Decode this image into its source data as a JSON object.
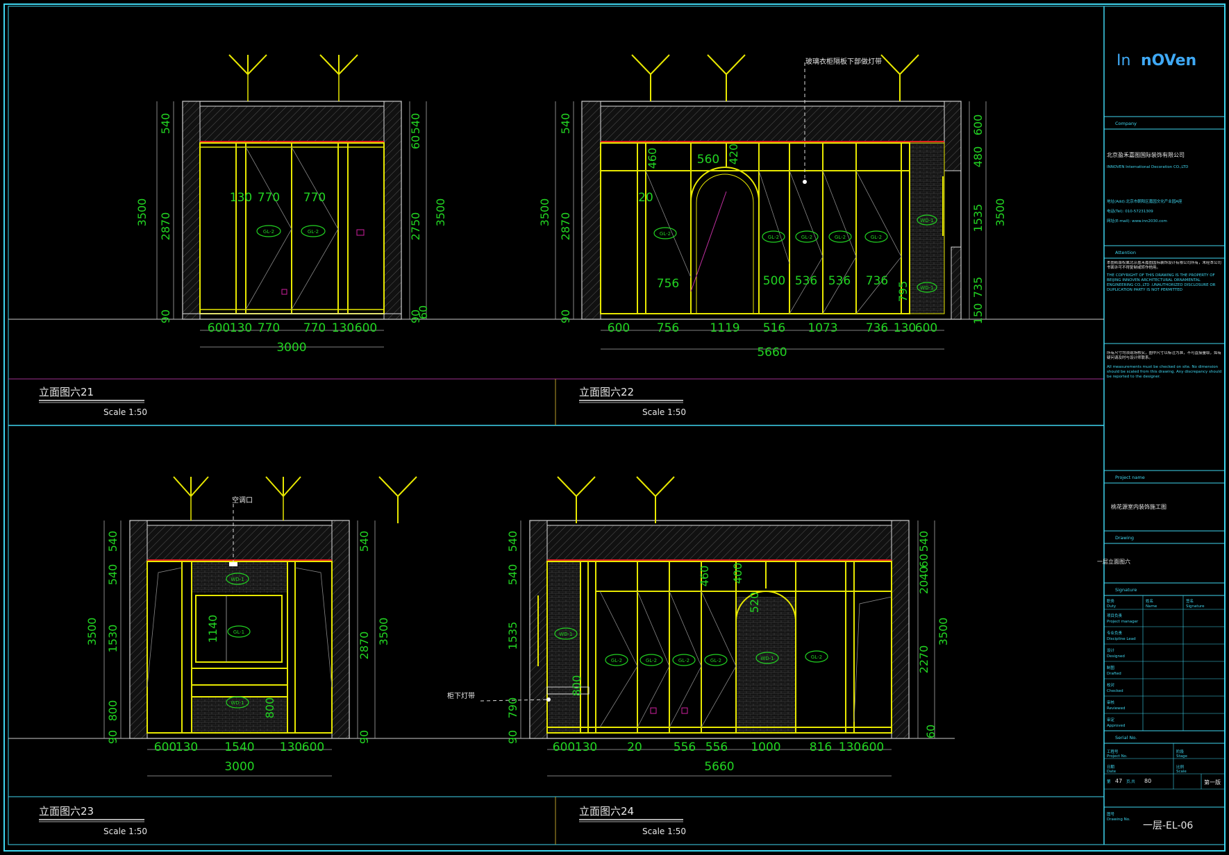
{
  "titleblock": {
    "logo_left": "In",
    "logo_right": "nOVen",
    "company_label": "Company",
    "company_name_cn": "北京盈禾嘉图国际装饰有限公司",
    "company_name_en": "INNOVEN International Decoration CO.,LTD",
    "address": "地址(Add):北京市朝阳区嘉园文化产业园A座",
    "tel": "电话(Tel): 010-57231309",
    "email": "网址(E-mail): www.inn2030.com",
    "attention_label": "Attention",
    "attention_cn": "本图纸版权属北京盈禾嘉图国际装饰设计有限公司所有，未经本公司书面许可不得复制或转作他用。",
    "attention_en": "THE COPYRIGHT OF THIS DRAWING IS THE PROPERTY OF BEIJING INNOVEN ARCHITECTURAL ORNAMENTAL ENGINEERING CO.,LTD .UNAUTHORIZED DISCLOSURE OR DUPLICATION PARTY IS NOT PERMITTED",
    "note_cn": "所有尺寸均须现场核实，图中尺寸以标注为准，不可直接量取，如有疑问请及时与设计师联系。",
    "note_en": "All measurements must be checked on site. No dimension should be scaled from this drawing. Any discrepancy should be reported to the designer.",
    "project_label": "Project name",
    "project_name": "桃花源室内装饰施工图",
    "drawing_label": "Drawing",
    "drawing_name": "一层立面图六",
    "signature_label": "Signature",
    "sig_cols": [
      "职务",
      "姓名",
      "签名"
    ],
    "sig_cols_en": [
      "Duty",
      "Name",
      "Signature"
    ],
    "sig_rows": [
      {
        "cn": "项目负责",
        "en": "Project manager"
      },
      {
        "cn": "专业负责",
        "en": "Discipline Lead"
      },
      {
        "cn": "设计",
        "en": "Designed"
      },
      {
        "cn": "制图",
        "en": "Drafted"
      },
      {
        "cn": "校对",
        "en": "Checked"
      },
      {
        "cn": "审核",
        "en": "Reviewed"
      },
      {
        "cn": "审定",
        "en": "Approved"
      }
    ],
    "serial_label": "Serial No.",
    "project_no": "工程号",
    "project_no_en": "Project No.",
    "stage": "阶段",
    "stage_en": "Stage",
    "date": "日期",
    "date_en": "Date",
    "ratio": "比例",
    "ratio_en": "Scale",
    "sheet_label": "第",
    "sheet_num": "47",
    "sheet_of": "页,共",
    "total": "80",
    "rev": "第一版",
    "drawing_no_label": "图号",
    "drawing_no_en": "Drawing No.",
    "drawing_no": "一层-EL-06"
  },
  "views": [
    {
      "title": "立面图六21",
      "scale": "Scale  1:50"
    },
    {
      "title": "立面图六22",
      "scale": "Scale  1:50"
    },
    {
      "title": "立面图六23",
      "scale": "Scale  1:50"
    },
    {
      "title": "立面图六24",
      "scale": "Scale  1:50"
    }
  ],
  "annotations": {
    "a22": "玻璃衣柜隔板下部做灯带",
    "a23": "空调口",
    "a24": "柜下灯带"
  },
  "v21": {
    "bottom": [
      "600",
      "130",
      "770",
      "770",
      "130",
      "600"
    ],
    "total": "3000",
    "left": [
      "540",
      "2870",
      "90"
    ],
    "left_total": "3500",
    "right": [
      "540",
      "60",
      "2750",
      "60",
      "90"
    ],
    "right_total": "3500",
    "inner": [
      "130",
      "770",
      "770"
    ],
    "tags": [
      "GL-2",
      "GL-2"
    ]
  },
  "v22": {
    "bottom": [
      "600",
      "756",
      "1119",
      "516",
      "1073",
      "736",
      "130",
      "600"
    ],
    "total": "5660",
    "left": [
      "540",
      "2870",
      "90"
    ],
    "left_total": "3500",
    "right": [
      "600",
      "480",
      "1535",
      "735",
      "150"
    ],
    "right_total": "3500",
    "inner": [
      "460",
      "560",
      "420",
      "20",
      "756",
      "500",
      "536",
      "536",
      "736",
      "795"
    ],
    "tags": [
      "GL-2",
      "GL-2",
      "GL-2",
      "GL-2",
      "GL-2",
      "WD-1",
      "WD-1"
    ]
  },
  "v23": {
    "bottom": [
      "600",
      "130",
      "1540",
      "130",
      "600"
    ],
    "total": "3000",
    "left": [
      "540",
      "540",
      "1530",
      "800",
      "90"
    ],
    "left_total": "3500",
    "right": [
      "540",
      "2870",
      "90"
    ],
    "right_total": "3500",
    "inner": [
      "1140",
      "800"
    ],
    "tags": [
      "WD-1",
      "GL-1",
      "WD-1"
    ]
  },
  "v24": {
    "bottom": [
      "600",
      "130",
      "20",
      "556",
      "556",
      "1000",
      "816",
      "130",
      "600"
    ],
    "total": "5660",
    "left": [
      "540",
      "540",
      "1535",
      "790",
      "90"
    ],
    "left_total": "3500",
    "right": [
      "540",
      "20",
      "40",
      "60",
      "60",
      "2270",
      "60"
    ],
    "right_total": "3500",
    "inner": [
      "460",
      "400",
      "520",
      "800"
    ],
    "tags": [
      "WD-1",
      "GL-2",
      "GL-2",
      "GL-2",
      "GL-2",
      "WD-1",
      "GL-2"
    ]
  }
}
